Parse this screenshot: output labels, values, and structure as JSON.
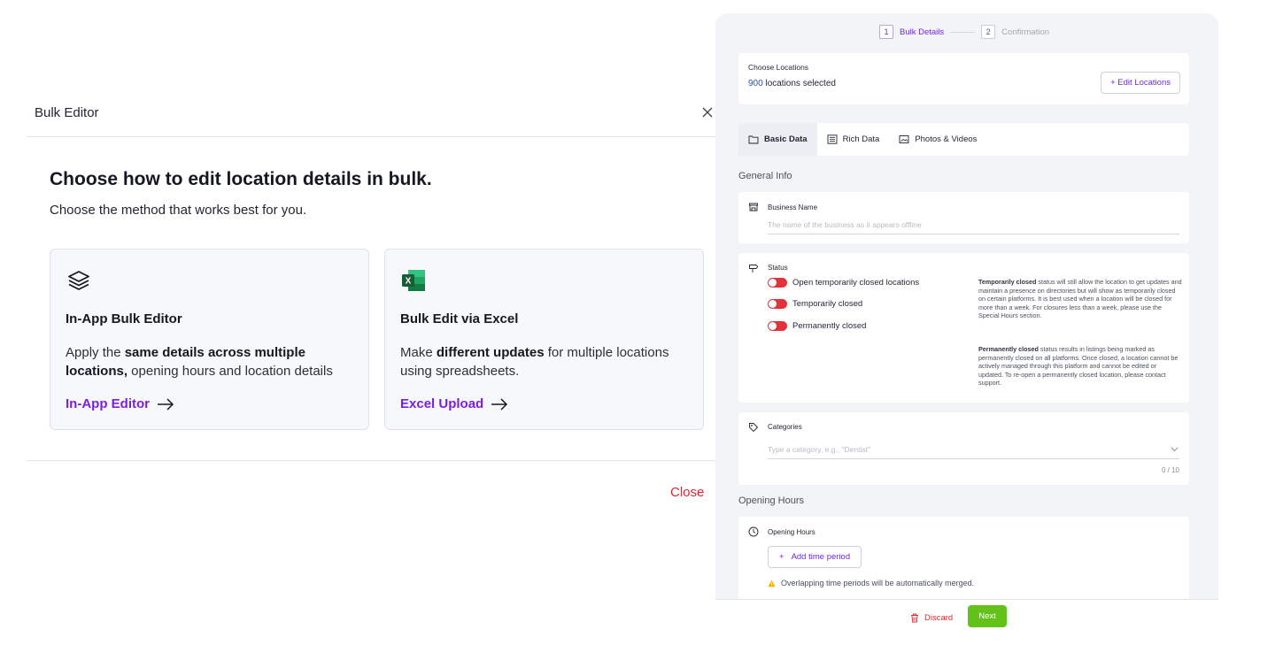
{
  "modal": {
    "title": "Bulk Editor",
    "heading": "Choose how to edit location details in bulk.",
    "subheading": "Choose the method that works best for you.",
    "close_label": "Close",
    "cards": [
      {
        "icon": "layers-icon",
        "title": "In-App Bulk Editor",
        "desc_pre": "Apply the ",
        "desc_bold": "same details across multiple locations,",
        "desc_post": " opening hours and location details",
        "link": "In-App Editor"
      },
      {
        "icon": "excel-icon",
        "title": "Bulk Edit via Excel",
        "desc_pre": "Make ",
        "desc_bold": "different updates",
        "desc_post": " for multiple locations using spreadsheets.",
        "link": "Excel Upload"
      }
    ]
  },
  "panel": {
    "steps": [
      {
        "num": "1",
        "label": "Bulk Details",
        "active": true
      },
      {
        "num": "2",
        "label": "Confirmation",
        "active": false
      }
    ],
    "locations": {
      "label": "Choose Locations",
      "count": "900",
      "count_suffix": " locations selected",
      "edit_button": "+ Edit Locations"
    },
    "tabs": [
      {
        "label": "Basic Data",
        "icon": "folder-icon",
        "active": true
      },
      {
        "label": "Rich Data",
        "icon": "list-icon",
        "active": false
      },
      {
        "label": "Photos & Videos",
        "icon": "image-icon",
        "active": false
      }
    ],
    "general_info_title": "General Info",
    "business_name": {
      "label": "Business Name",
      "placeholder": "The name of the business as it appears offline"
    },
    "status": {
      "label": "Status",
      "toggles": [
        "Open temporarily closed locations",
        "Temporarily closed",
        "Permanently closed"
      ],
      "note1_bold": "Temporarily closed",
      "note1_text": " status will still allow the location to get updates and maintain a presence on directories but will show as temporarily closed on certain platforms. It is best used when a location will be closed for more than a week. For closures less than a week, please use the Special Hours section.",
      "note2_bold": "Permanently closed",
      "note2_text": " status results in listings being marked as permanently closed on all platforms. Once closed, a location cannot be actively managed through this platform and cannot be edited or updated. To re-open a permanently closed location, please contact support."
    },
    "categories": {
      "label": "Categories",
      "placeholder": "Type a category, e.g., \"Dentist\"",
      "count": "0 / 10"
    },
    "opening_hours_title": "Opening Hours",
    "opening_hours": {
      "label": "Opening Hours",
      "add_button": "Add time period",
      "warning": "Overlapping time periods will be automatically merged."
    },
    "footer": {
      "discard": "Discard",
      "next": "Next"
    }
  },
  "colors": {
    "accent": "#6c2bd9",
    "danger": "#e0262e",
    "success": "#62c21a",
    "excel": "#1d7044"
  }
}
